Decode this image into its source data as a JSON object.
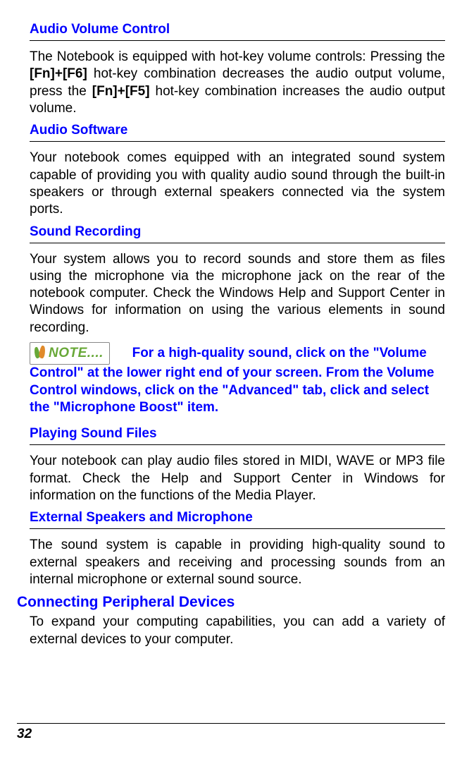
{
  "sections": {
    "audio_volume_control": {
      "heading": "Audio Volume Control",
      "body_pre": "The Notebook is equipped with hot-key volume controls: Pressing the ",
      "key1": "[Fn]+[F6]",
      "body_mid": " hot-key combination decreases the audio output volume, press the ",
      "key2": "[Fn]+[F5]",
      "body_post": " hot-key combination increases the audio output volume."
    },
    "audio_software": {
      "heading": "Audio Software",
      "body": "Your notebook comes equipped with an integrated sound system capable of providing you with quality audio sound through the built-in speakers or through external speakers connected via the system ports."
    },
    "sound_recording": {
      "heading": "Sound Recording",
      "body": "Your system allows you to record sounds and store them as files using the microphone via the microphone jack on the rear of the notebook computer.  Check the Windows Help and Support Center in Windows for information on using the various elements in sound recording."
    },
    "note": {
      "badge": "NOTE....",
      "line1": "For a high-quality sound, click on the",
      "rest": "\"Volume Control\" at the lower right end of your screen. From the Volume Control windows, click on the \"Advanced\" tab, click and select the \"Microphone Boost\" item."
    },
    "playing_sound_files": {
      "heading": "Playing Sound Files",
      "body": "Your notebook can play audio files stored in MIDI, WAVE or MP3 file format.  Check the Help and Support Center in Windows for information on the functions of the Media Player."
    },
    "external_speakers": {
      "heading": "External Speakers and Microphone",
      "body": "The sound system is capable in providing high-quality sound to external speakers and receiving and processing sounds from an internal microphone or external sound source."
    },
    "connecting_peripherals": {
      "heading": "Connecting Peripheral Devices",
      "body": "To expand your computing capabilities, you can add a variety of external devices to your computer."
    }
  },
  "page_number": "32"
}
